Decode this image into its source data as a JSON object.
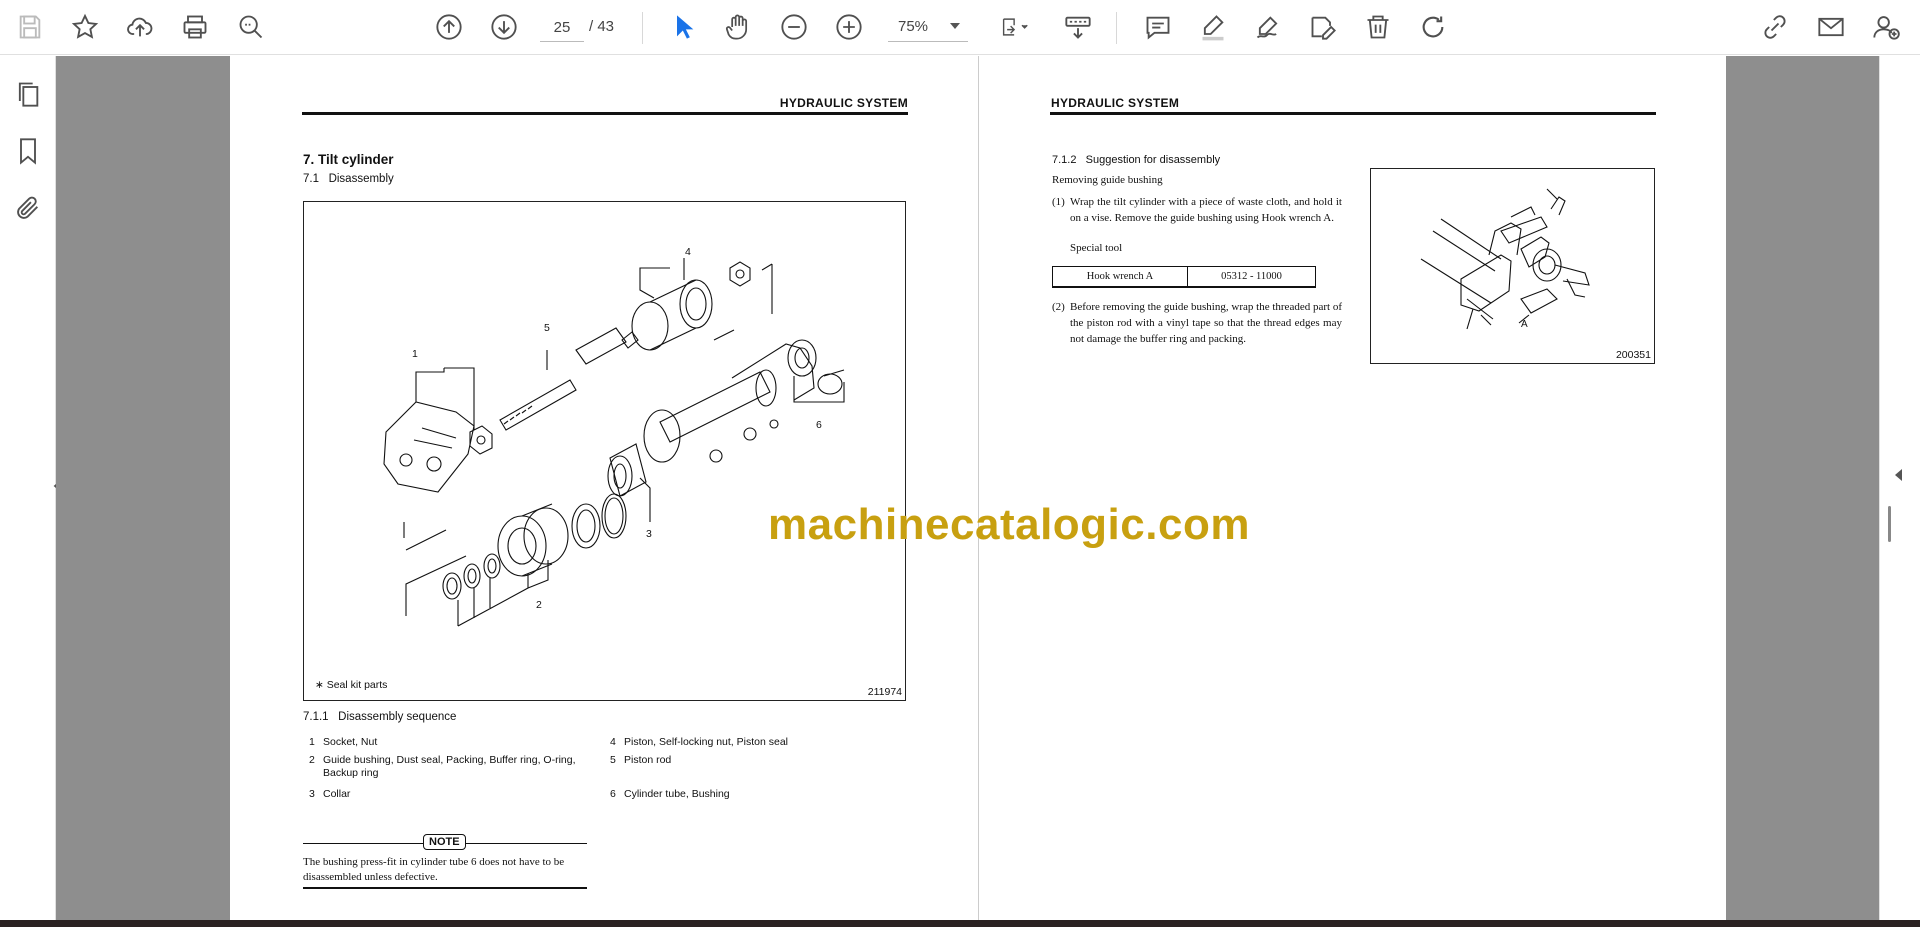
{
  "toolbar": {
    "page_current": "25",
    "page_total": "/ 43",
    "zoom": "75%"
  },
  "left_page": {
    "header": "HYDRAULIC SYSTEM",
    "section_title": "7. Tilt cylinder",
    "subsection_title": "7.1   Disassembly",
    "figure": {
      "caption": "∗ Seal kit parts",
      "number": "211974",
      "callouts": [
        "1",
        "2",
        "3",
        "4",
        "5",
        "6"
      ]
    },
    "sequence_title": "7.1.1   Disassembly sequence",
    "sequence": [
      {
        "num": "1",
        "text": "Socket, Nut"
      },
      {
        "num": "2",
        "text": "Guide bushing, Dust seal, Packing, Buffer ring, O-ring, Backup ring"
      },
      {
        "num": "3",
        "text": "Collar"
      },
      {
        "num": "4",
        "text": "Piston, Self-locking nut, Piston seal"
      },
      {
        "num": "5",
        "text": "Piston rod"
      },
      {
        "num": "6",
        "text": "Cylinder tube, Bushing"
      }
    ],
    "note_label": "NOTE",
    "note_text": "The bushing press-fit in cylinder tube 6 does not have to be disassembled unless defective."
  },
  "right_page": {
    "header": "HYDRAULIC SYSTEM",
    "subsection_title": "7.1.2   Suggestion for disassembly",
    "intro": "Removing guide bushing",
    "steps": [
      {
        "num": "(1)",
        "text": "Wrap the tilt cylinder with a piece of waste cloth, and hold it on a vise. Remove the guide bushing using Hook wrench A."
      },
      {
        "num": "(2)",
        "text": "Before removing the guide bushing, wrap the threaded part of the piston rod with a vinyl tape so that the thread edges may not damage the buffer ring and packing."
      }
    ],
    "special_tool_label": "Special tool",
    "tool_table": {
      "name": "Hook wrench A",
      "part_no": "05312 - 11000"
    },
    "figure": {
      "number": "200351",
      "callout": "A"
    }
  },
  "watermark": "machinecatalogic.com"
}
